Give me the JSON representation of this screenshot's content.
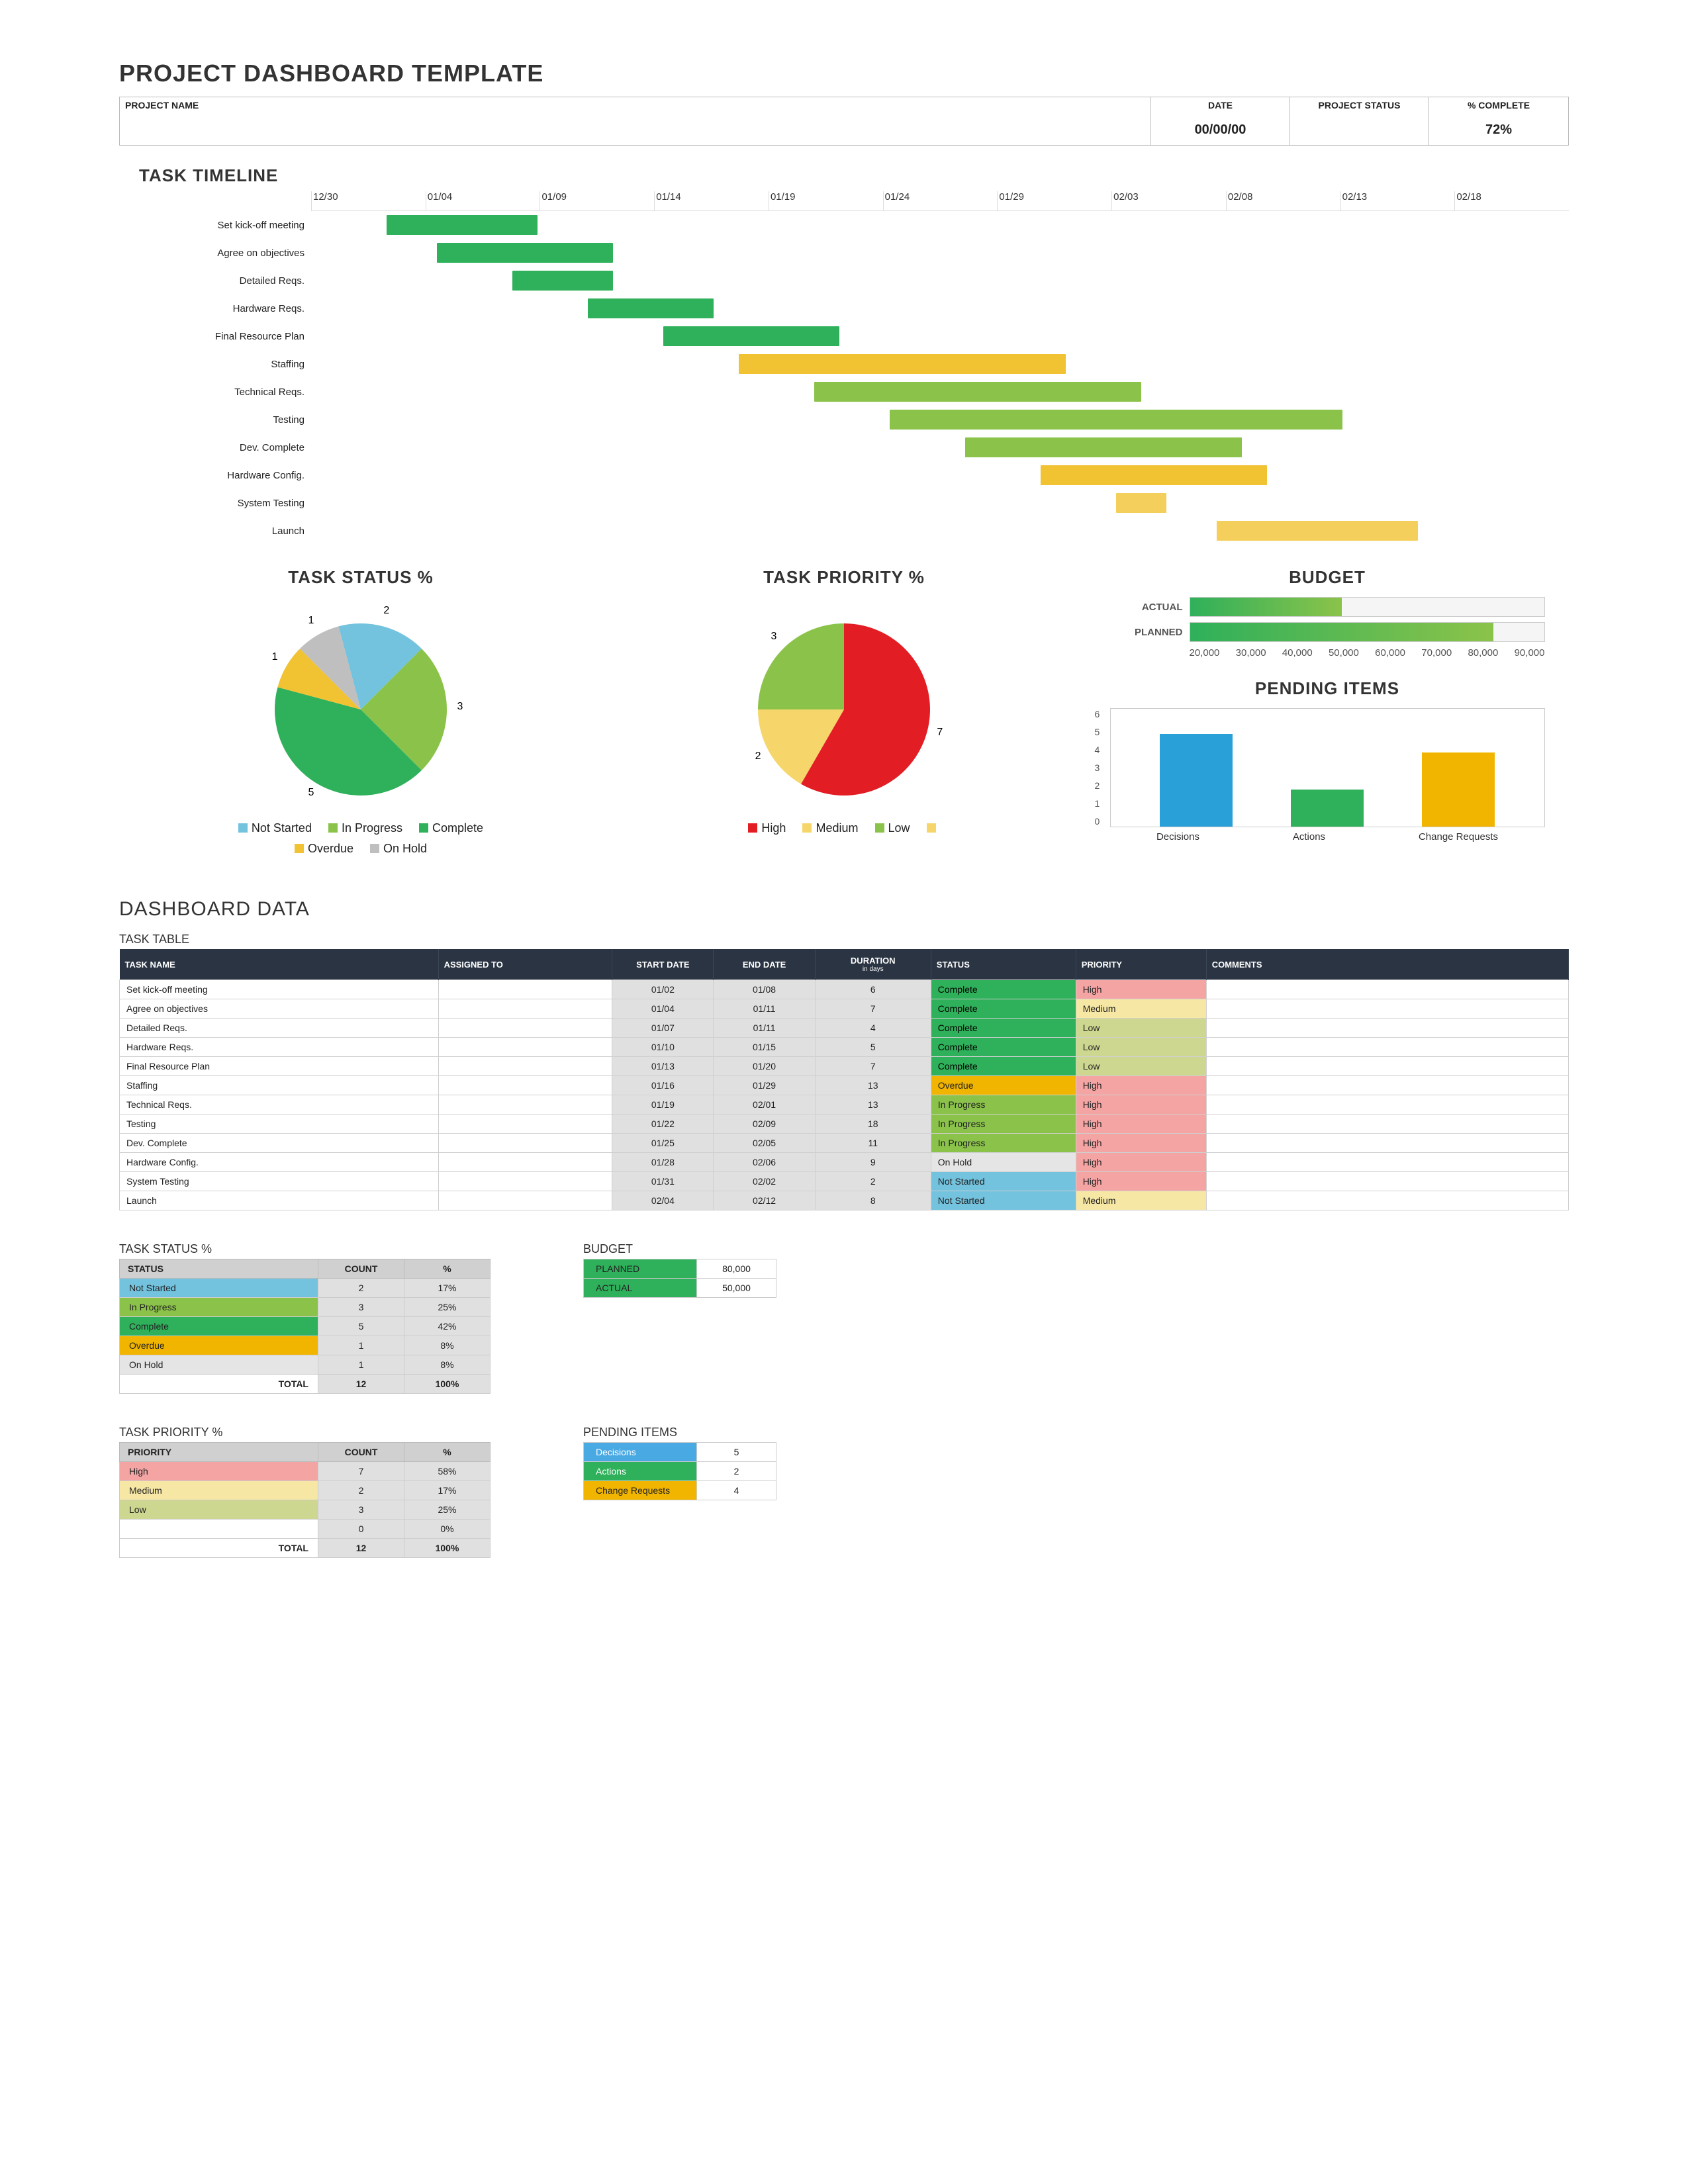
{
  "page_title": "PROJECT DASHBOARD TEMPLATE",
  "header": {
    "name_label": "PROJECT NAME",
    "name_value": "",
    "date_label": "DATE",
    "date_value": "00/00/00",
    "status_label": "PROJECT STATUS",
    "status_value": "",
    "complete_label": "% COMPLETE",
    "complete_value": "72%"
  },
  "timeline_title": "TASK TIMELINE",
  "task_status_title": "TASK STATUS %",
  "task_priority_title": "TASK PRIORITY %",
  "budget_title": "BUDGET",
  "pending_title": "PENDING ITEMS",
  "dashboard_data_title": "DASHBOARD DATA",
  "task_table_title": "TASK TABLE",
  "task_status_small_title": "TASK STATUS %",
  "budget_small_title": "BUDGET",
  "task_priority_small_title": "TASK PRIORITY %",
  "pending_small_title": "PENDING ITEMS",
  "legend": {
    "not_started": "Not Started",
    "in_progress": "In Progress",
    "complete": "Complete",
    "overdue": "Overdue",
    "on_hold": "On Hold",
    "high": "High",
    "medium": "Medium",
    "low": "Low"
  },
  "table_headers": {
    "task": "TASK NAME",
    "assigned": "ASSIGNED TO",
    "start": "START DATE",
    "end": "END DATE",
    "duration": "DURATION",
    "duration_sub": "in days",
    "status": "STATUS",
    "priority": "PRIORITY",
    "comments": "COMMENTS"
  },
  "small_headers": {
    "status": "STATUS",
    "priority": "PRIORITY",
    "count": "COUNT",
    "pct": "%"
  },
  "budget_small": {
    "planned_label": "PLANNED",
    "planned_value": "80,000",
    "actual_label": "ACTUAL",
    "actual_value": "50,000"
  },
  "pending_small": {
    "decisions_label": "Decisions",
    "decisions_value": "5",
    "actions_label": "Actions",
    "actions_value": "2",
    "change_label": "Change Requests",
    "change_value": "4"
  },
  "totals": {
    "label": "TOTAL",
    "status_count": "12",
    "status_pct": "100%",
    "prio_count": "12",
    "prio_pct": "100%"
  },
  "budget_chart_labels": {
    "actual": "ACTUAL",
    "planned": "PLANNED"
  },
  "chart_data": [
    {
      "type": "gantt",
      "title": "TASK TIMELINE",
      "x_ticks": [
        "12/30",
        "01/04",
        "01/09",
        "01/14",
        "01/19",
        "01/24",
        "01/29",
        "02/03",
        "02/08",
        "02/13",
        "02/18"
      ],
      "tasks": [
        {
          "name": "Set kick-off meeting",
          "start": "01/02",
          "end": "01/08",
          "status": "Complete"
        },
        {
          "name": "Agree on objectives",
          "start": "01/04",
          "end": "01/11",
          "status": "Complete"
        },
        {
          "name": "Detailed Reqs.",
          "start": "01/07",
          "end": "01/11",
          "status": "Complete"
        },
        {
          "name": "Hardware Reqs.",
          "start": "01/10",
          "end": "01/15",
          "status": "Complete"
        },
        {
          "name": "Final Resource Plan",
          "start": "01/13",
          "end": "01/20",
          "status": "Complete"
        },
        {
          "name": "Staffing",
          "start": "01/16",
          "end": "01/29",
          "status": "Overdue"
        },
        {
          "name": "Technical Reqs.",
          "start": "01/19",
          "end": "02/01",
          "status": "In Progress"
        },
        {
          "name": "Testing",
          "start": "01/22",
          "end": "02/09",
          "status": "In Progress"
        },
        {
          "name": "Dev. Complete",
          "start": "01/25",
          "end": "02/05",
          "status": "In Progress"
        },
        {
          "name": "Hardware Config.",
          "start": "01/28",
          "end": "02/06",
          "status": "On Hold"
        },
        {
          "name": "System Testing",
          "start": "01/31",
          "end": "02/02",
          "status": "Not Started"
        },
        {
          "name": "Launch",
          "start": "02/04",
          "end": "02/12",
          "status": "Not Started"
        }
      ]
    },
    {
      "type": "pie",
      "title": "TASK STATUS %",
      "series": [
        {
          "name": "Not Started",
          "value": 2,
          "color": "#73c2de"
        },
        {
          "name": "In Progress",
          "value": 3,
          "color": "#8bc34a"
        },
        {
          "name": "Complete",
          "value": 5,
          "color": "#2fb05a"
        },
        {
          "name": "Overdue",
          "value": 1,
          "color": "#f1c232"
        },
        {
          "name": "On Hold",
          "value": 1,
          "color": "#bfbfbf"
        }
      ]
    },
    {
      "type": "pie",
      "title": "TASK PRIORITY %",
      "series": [
        {
          "name": "High",
          "value": 7,
          "color": "#e21e24"
        },
        {
          "name": "Medium",
          "value": 2,
          "color": "#f6d66a"
        },
        {
          "name": "Low",
          "value": 3,
          "color": "#8bc34a"
        },
        {
          "name": "",
          "value": 0,
          "color": "#f6d66a"
        }
      ]
    },
    {
      "type": "bar",
      "title": "BUDGET",
      "orientation": "horizontal",
      "categories": [
        "ACTUAL",
        "PLANNED"
      ],
      "values": [
        50000,
        80000
      ],
      "xlim": [
        20000,
        90000
      ],
      "x_ticks": [
        "20,000",
        "30,000",
        "40,000",
        "50,000",
        "60,000",
        "70,000",
        "80,000",
        "90,000"
      ]
    },
    {
      "type": "bar",
      "title": "PENDING ITEMS",
      "categories": [
        "Decisions",
        "Actions",
        "Change Requests"
      ],
      "values": [
        5,
        2,
        4
      ],
      "colors": [
        "#2aa0d8",
        "#2fb05a",
        "#f1b500"
      ],
      "ylim": [
        0,
        6
      ],
      "y_ticks": [
        "0",
        "1",
        "2",
        "3",
        "4",
        "5",
        "6"
      ]
    }
  ],
  "task_table": [
    {
      "name": "Set kick-off meeting",
      "assigned": "",
      "start": "01/02",
      "end": "01/08",
      "duration": "6",
      "status": "Complete",
      "priority": "High",
      "comments": ""
    },
    {
      "name": "Agree on objectives",
      "assigned": "",
      "start": "01/04",
      "end": "01/11",
      "duration": "7",
      "status": "Complete",
      "priority": "Medium",
      "comments": ""
    },
    {
      "name": "Detailed Reqs.",
      "assigned": "",
      "start": "01/07",
      "end": "01/11",
      "duration": "4",
      "status": "Complete",
      "priority": "Low",
      "comments": ""
    },
    {
      "name": "Hardware Reqs.",
      "assigned": "",
      "start": "01/10",
      "end": "01/15",
      "duration": "5",
      "status": "Complete",
      "priority": "Low",
      "comments": ""
    },
    {
      "name": "Final Resource Plan",
      "assigned": "",
      "start": "01/13",
      "end": "01/20",
      "duration": "7",
      "status": "Complete",
      "priority": "Low",
      "comments": ""
    },
    {
      "name": "Staffing",
      "assigned": "",
      "start": "01/16",
      "end": "01/29",
      "duration": "13",
      "status": "Overdue",
      "priority": "High",
      "comments": ""
    },
    {
      "name": "Technical Reqs.",
      "assigned": "",
      "start": "01/19",
      "end": "02/01",
      "duration": "13",
      "status": "In Progress",
      "priority": "High",
      "comments": ""
    },
    {
      "name": "Testing",
      "assigned": "",
      "start": "01/22",
      "end": "02/09",
      "duration": "18",
      "status": "In Progress",
      "priority": "High",
      "comments": ""
    },
    {
      "name": "Dev. Complete",
      "assigned": "",
      "start": "01/25",
      "end": "02/05",
      "duration": "11",
      "status": "In Progress",
      "priority": "High",
      "comments": ""
    },
    {
      "name": "Hardware Config.",
      "assigned": "",
      "start": "01/28",
      "end": "02/06",
      "duration": "9",
      "status": "On Hold",
      "priority": "High",
      "comments": ""
    },
    {
      "name": "System Testing",
      "assigned": "",
      "start": "01/31",
      "end": "02/02",
      "duration": "2",
      "status": "Not Started",
      "priority": "High",
      "comments": ""
    },
    {
      "name": "Launch",
      "assigned": "",
      "start": "02/04",
      "end": "02/12",
      "duration": "8",
      "status": "Not Started",
      "priority": "Medium",
      "comments": ""
    }
  ],
  "status_summary": [
    {
      "name": "Not Started",
      "count": "2",
      "pct": "17%",
      "cls": "bg-notstarted"
    },
    {
      "name": "In Progress",
      "count": "3",
      "pct": "25%",
      "cls": "bg-inprogress"
    },
    {
      "name": "Complete",
      "count": "5",
      "pct": "42%",
      "cls": "bg-complete2"
    },
    {
      "name": "Overdue",
      "count": "1",
      "pct": "8%",
      "cls": "bg-overdue"
    },
    {
      "name": "On Hold",
      "count": "1",
      "pct": "8%",
      "cls": "bg-onhold"
    }
  ],
  "priority_summary": [
    {
      "name": "High",
      "count": "7",
      "pct": "58%",
      "cls": "bg-high"
    },
    {
      "name": "Medium",
      "count": "2",
      "pct": "17%",
      "cls": "bg-medium"
    },
    {
      "name": "Low",
      "count": "3",
      "pct": "25%",
      "cls": "bg-low"
    },
    {
      "name": "",
      "count": "0",
      "pct": "0%",
      "cls": ""
    }
  ]
}
